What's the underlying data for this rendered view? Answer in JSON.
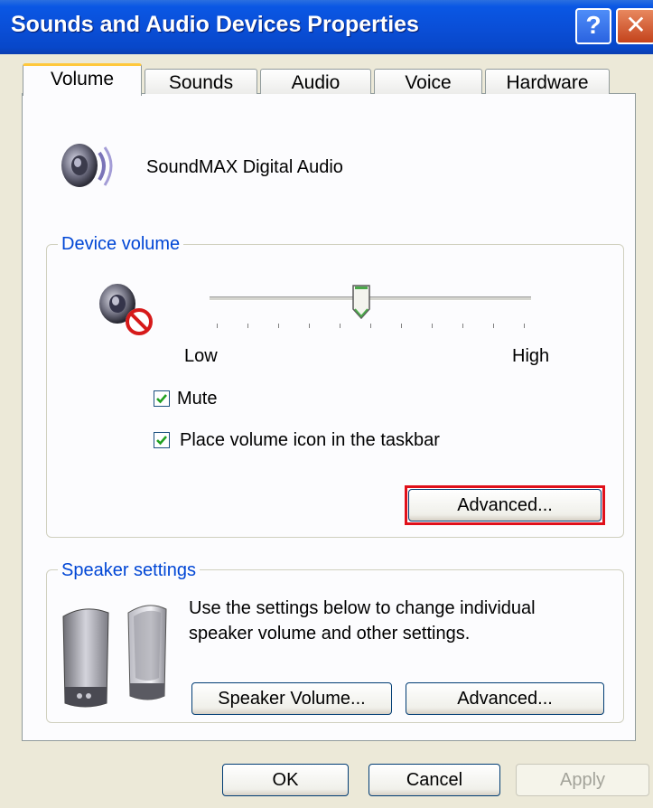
{
  "window": {
    "title": "Sounds and Audio Devices Properties",
    "help_glyph": "?",
    "close_glyph": "✕"
  },
  "tabs": [
    {
      "label": "Volume",
      "active": true
    },
    {
      "label": "Sounds",
      "active": false
    },
    {
      "label": "Audio",
      "active": false
    },
    {
      "label": "Voice",
      "active": false
    },
    {
      "label": "Hardware",
      "active": false
    }
  ],
  "device": {
    "icon": "speaker-icon",
    "name": "SoundMAX Digital Audio"
  },
  "device_volume": {
    "group_label": "Device volume",
    "muted_icon": "speaker-muted-icon",
    "slider": {
      "min_label": "Low",
      "max_label": "High",
      "level": 0.47,
      "ticks": 11
    },
    "mute": {
      "label": "Mute",
      "checked": true
    },
    "taskbar": {
      "label": "Place volume icon in the taskbar",
      "checked": true
    },
    "advanced_label": "Advanced..."
  },
  "speaker_settings": {
    "group_label": "Speaker settings",
    "icon": "speakers-icon",
    "description_line1": "Use the settings below to change individual",
    "description_line2": "speaker volume and other settings.",
    "speaker_volume_label": "Speaker Volume...",
    "advanced_label": "Advanced..."
  },
  "footer": {
    "ok_label": "OK",
    "cancel_label": "Cancel",
    "apply_label": "Apply",
    "apply_enabled": false
  },
  "colors": {
    "title_bar": "#0a4fd8",
    "group_label": "#0046d5",
    "highlight": "#e0101a",
    "checkbox_check": "#21a121"
  }
}
